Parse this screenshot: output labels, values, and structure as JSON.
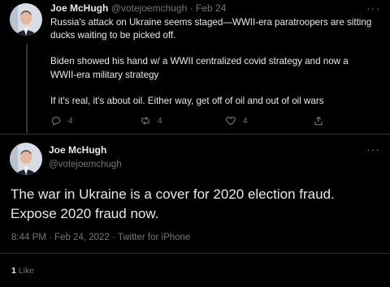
{
  "tweet1": {
    "author_name": "Joe McHugh",
    "handle": "@votejoemchugh",
    "separator": "·",
    "date": "Feb 24",
    "paragraphs": [
      "Russia's attack on Ukraine seems staged—WWII-era paratroopers are sitting ducks waiting to be picked off.",
      "Biden showed his hand w/ a WWII centralized covid strategy and now a WWII-era military strategy",
      "If it's real, it's about oil. Either way, get off of oil and out of oil wars"
    ],
    "actions": {
      "reply_count": "4",
      "retweet_count": "4",
      "like_count": "4"
    },
    "more_label": "···"
  },
  "tweet2": {
    "author_name": "Joe McHugh",
    "handle": "@votejoemchugh",
    "text": "The war in Ukraine is a cover for 2020 election fraud. Expose 2020 fraud now.",
    "meta": "8:44 PM · Feb 24, 2022 · Twitter for iPhone",
    "like_count": "1",
    "like_label": "Like",
    "more_label": "···"
  },
  "colors": {
    "background": "#000000",
    "text": "#e7e9ea",
    "secondary": "#71767b",
    "divider": "#2f3336"
  },
  "icons": [
    "avatar",
    "reply-icon",
    "retweet-icon",
    "like-icon",
    "share-icon",
    "more-icon"
  ]
}
